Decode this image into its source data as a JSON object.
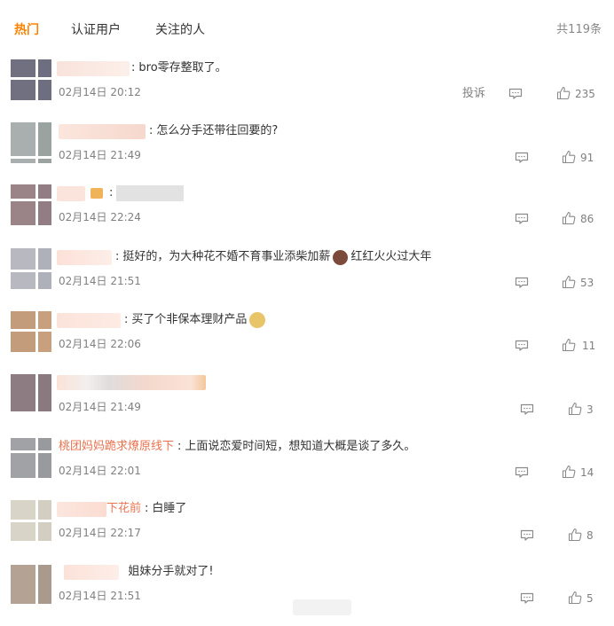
{
  "tabs": [
    {
      "label": "热门",
      "active": true
    },
    {
      "label": "认证用户",
      "active": false
    },
    {
      "label": "关注的人",
      "active": false
    }
  ],
  "comment_count": "共119条",
  "report_label": "投诉",
  "colors": {
    "accent": "#ff8200",
    "username": "#eb7350",
    "meta": "#808080"
  },
  "comments": [
    {
      "username": "",
      "text": "bro零存整取了。",
      "time": "02月14日 20:12",
      "likes": "235"
    },
    {
      "username": "",
      "text": "怎么分手还带往回要的?",
      "time": "02月14日 21:49",
      "likes": "91"
    },
    {
      "username": "",
      "text": "",
      "time": "02月14日 22:24",
      "likes": "86"
    },
    {
      "username": "",
      "text": "挺好的，为大种花不婚不育事业添柴加薪",
      "text2": "红红火火过大年",
      "time": "02月14日 21:51",
      "likes": "53"
    },
    {
      "username": "",
      "text": "买了个非保本理财产品",
      "time": "02月14日 22:06",
      "likes": "11"
    },
    {
      "username": "",
      "text": "",
      "time": "02月14日 21:49",
      "likes": "3"
    },
    {
      "username": "桃团妈妈跪求燎原线下",
      "text": "上面说恋爱时间短，想知道大概是谈了多久。",
      "time": "02月14日 22:01",
      "likes": "14"
    },
    {
      "username": "下花前",
      "text": "白睡了",
      "time": "02月14日 22:17",
      "likes": "8"
    },
    {
      "username": "",
      "text": "姐妹分手就对了!",
      "time": "02月14日 21:51",
      "likes": "5"
    }
  ]
}
